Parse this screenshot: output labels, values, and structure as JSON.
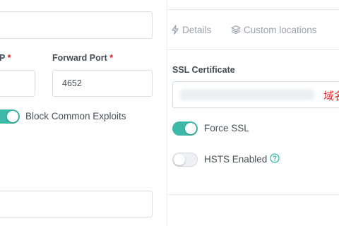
{
  "left": {
    "forward_ip_label_partial": "P",
    "required_marker": "*",
    "forward_port_label": "Forward Port",
    "forward_port_value": "4652",
    "block_exploits_label": "Block Common Exploits"
  },
  "tabs": [
    {
      "label": "Details",
      "icon": "bolt-icon"
    },
    {
      "label": "Custom locations",
      "icon": "layers-icon"
    }
  ],
  "ssl": {
    "certificate_label": "SSL Certificate",
    "certificate_suffix": "域名",
    "force_ssl_label": "Force SSL",
    "hsts_label": "HSTS Enabled",
    "hsts_help_icon": "question-circle-icon"
  },
  "colors": {
    "toggle_on": "#3eb8a8",
    "required": "#cd201f",
    "help_icon": "#3eb8a8",
    "certificate_suffix": "#e03131"
  },
  "toggles": {
    "block_exploits": true,
    "force_ssl": true,
    "hsts_enabled": false
  }
}
